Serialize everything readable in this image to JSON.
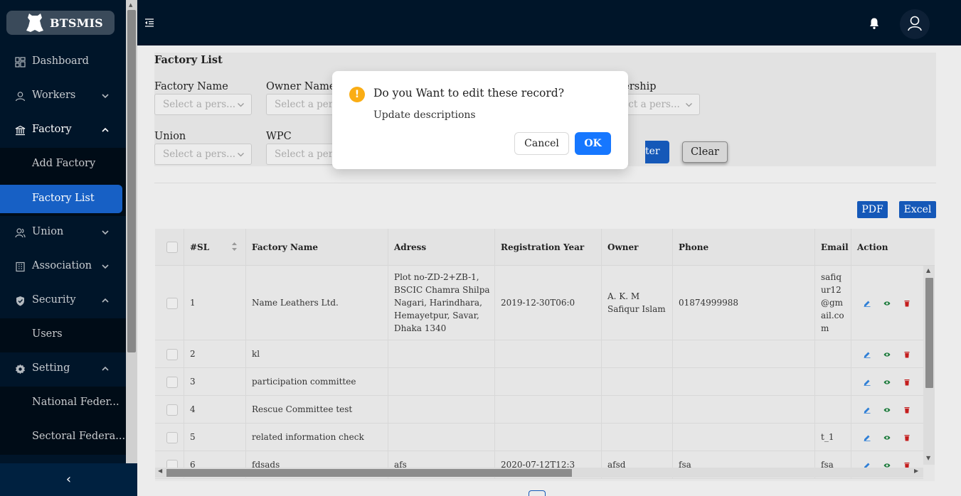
{
  "app": {
    "logo_text": "BTSMIS"
  },
  "sidebar": {
    "items": [
      {
        "label": "Dashboard",
        "icon": "dashboard-icon"
      },
      {
        "label": "Workers",
        "icon": "user-icon",
        "chevron": "down"
      },
      {
        "label": "Factory",
        "icon": "bank-icon",
        "chevron": "up"
      },
      {
        "label": "Add Factory",
        "sub": true
      },
      {
        "label": "Factory List",
        "sub": true,
        "selected": true
      },
      {
        "label": "Union",
        "icon": "team-icon",
        "chevron": "down"
      },
      {
        "label": "Association",
        "icon": "building-icon",
        "chevron": "down"
      },
      {
        "label": "Security",
        "icon": "shield-icon",
        "chevron": "up"
      },
      {
        "label": "Users",
        "sub": true
      },
      {
        "label": "Setting",
        "icon": "gear-icon",
        "chevron": "up"
      },
      {
        "label": "National Feder...",
        "sub": true
      },
      {
        "label": "Sectoral Federa...",
        "sub": true
      }
    ],
    "collapse_icon": "‹"
  },
  "filters": {
    "title": "Factory List",
    "factory_name_label": "Factory Name",
    "owner_name_label": "Owner Name",
    "membership_label": "bership",
    "union_label": "Union",
    "wpc_label": "WPC",
    "placeholder_short": "Select a pers...",
    "placeholder_cut": "Select a pers",
    "placeholder_left": "elect a pers...",
    "filter_button": "ter",
    "clear_button": "Clear"
  },
  "export": {
    "pdf": "PDF",
    "excel": "Excel"
  },
  "table": {
    "headers": [
      "#SL",
      "Factory Name",
      "Adress",
      "Registration Year",
      "Owner",
      "Phone",
      "Email",
      "Action"
    ],
    "rows": [
      {
        "sl": "1",
        "name": "Name Leathers Ltd.",
        "address": "Plot no-ZD-2+ZB-1, BSCIC Chamra Shilpa Nagari, Harindhara, Hemayetpur, Savar, Dhaka 1340",
        "year": "2019-12-30T06:0",
        "owner": "A. K. M Safiqur Islam",
        "phone": "01874999988",
        "email": "safiqur12 @gmail.co m"
      },
      {
        "sl": "2",
        "name": "kl",
        "address": "",
        "year": "",
        "owner": "",
        "phone": "",
        "email": ""
      },
      {
        "sl": "3",
        "name": "participation committee",
        "address": "",
        "year": "",
        "owner": "",
        "phone": "",
        "email": ""
      },
      {
        "sl": "4",
        "name": "Rescue Committee test",
        "address": "",
        "year": "",
        "owner": "",
        "phone": "",
        "email": ""
      },
      {
        "sl": "5",
        "name": "related information check",
        "address": "",
        "year": "",
        "owner": "",
        "phone": "",
        "email": "t_1"
      },
      {
        "sl": "6",
        "name": "fdsads",
        "address": "afs",
        "year": "2020-07-12T12:3",
        "owner": "afsd",
        "phone": "fsa",
        "email": "fsa"
      }
    ]
  },
  "modal": {
    "title": "Do you Want to edit these record?",
    "description": "Update descriptions",
    "cancel": "Cancel",
    "ok": "OK",
    "icon": "exclamation-icon"
  },
  "colors": {
    "sidebar_bg": "#001529",
    "accent": "#1558b8",
    "modal_ok": "#1677ff",
    "warning": "#faad14",
    "delete": "#c41d1d",
    "view": "#1a7a3a",
    "edit": "#2f7fd6"
  }
}
